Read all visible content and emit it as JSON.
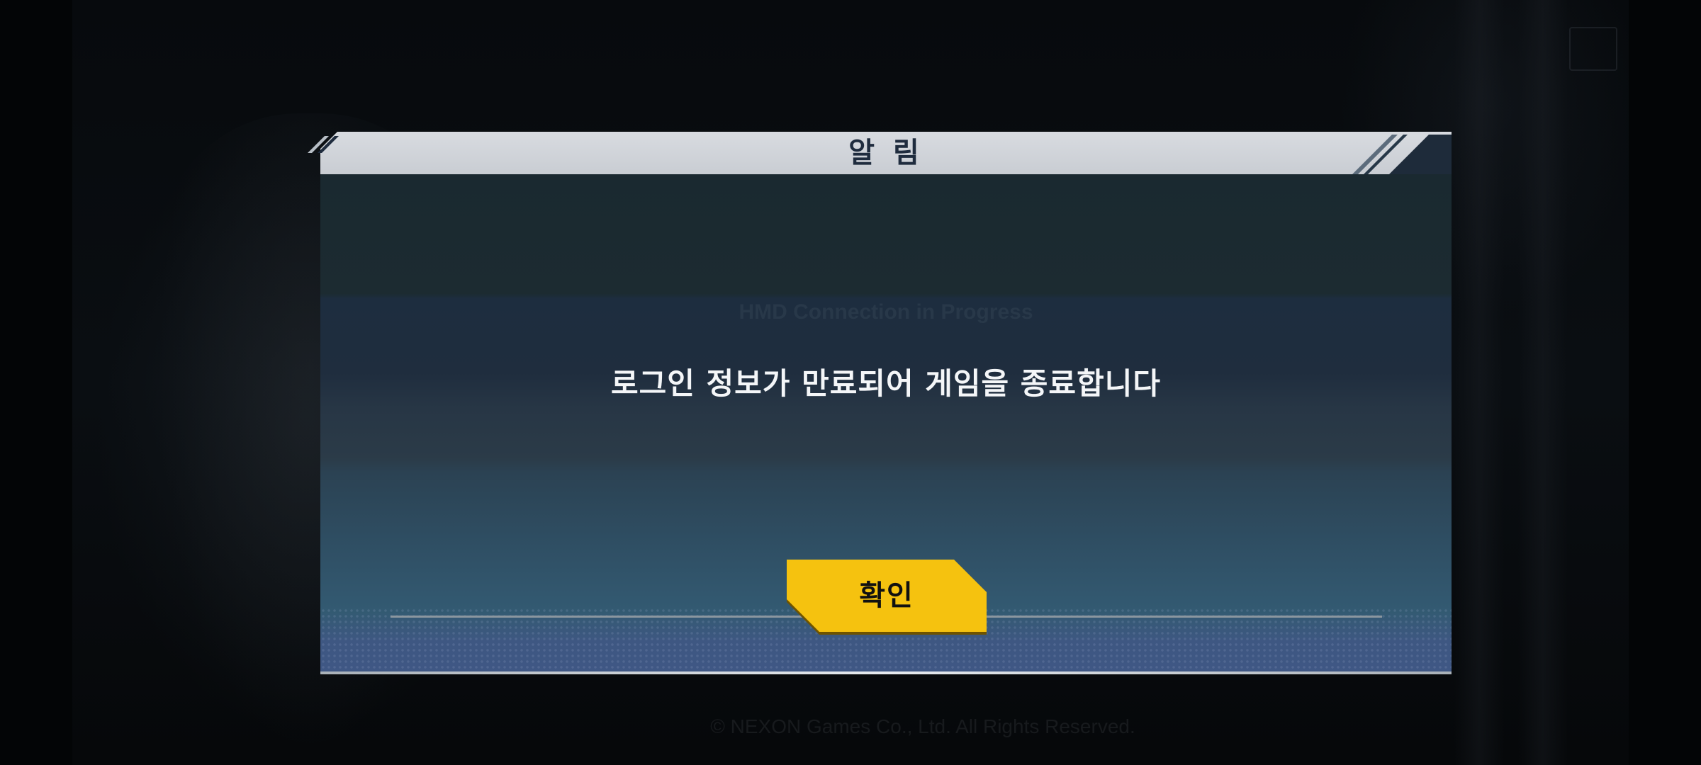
{
  "background": {
    "status_text": "HMD Connection in Progress",
    "footer_text": "© NEXON Games Co., Ltd. All Rights Reserved."
  },
  "dialog": {
    "title": "알 림",
    "message": "로그인 정보가 만료되어 게임을 종료합니다",
    "confirm_label": "확인"
  },
  "colors": {
    "header_bg": "#d5d8dd",
    "title_text": "#1f2c3e",
    "body_top": "#1a2930",
    "body_bottom": "#3f5784",
    "button_bg": "#f5c20f",
    "message_text": "#f4f6f8"
  }
}
